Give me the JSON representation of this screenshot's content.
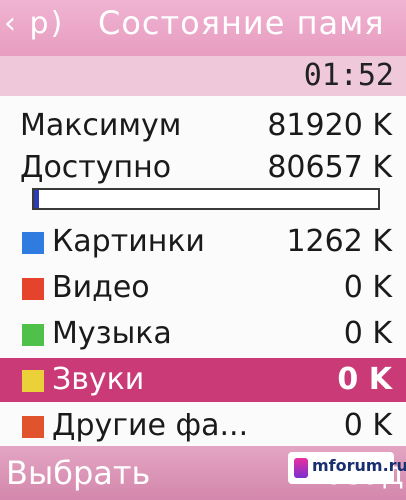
{
  "header": {
    "nav_glyph": "‹ р)",
    "title": "Состояние памя"
  },
  "status": {
    "time": "01:52"
  },
  "memory": {
    "max_label": "Максимум",
    "max_value": "81920 K",
    "free_label": "Доступно",
    "free_value": "80657 K",
    "used_fraction": 0.015
  },
  "categories": [
    {
      "label": "Картинки",
      "value": "1262 K",
      "color": "#2f7be0"
    },
    {
      "label": "Видео",
      "value": "0 K",
      "color": "#e5432b"
    },
    {
      "label": "Музыка",
      "value": "0 K",
      "color": "#4fc04a"
    },
    {
      "label": "Звуки",
      "value": "0 K",
      "color": "#ecd03a",
      "selected": true
    },
    {
      "label": "Другие фа...",
      "value": "0 K",
      "color": "#e0532c"
    }
  ],
  "softkeys": {
    "left": "Выбрать",
    "right": "Назад"
  },
  "watermark": {
    "text": "mforum.ru"
  }
}
